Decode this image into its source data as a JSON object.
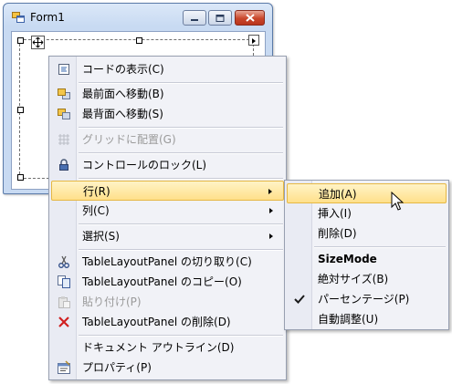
{
  "window": {
    "title": "Form1"
  },
  "context_menu": {
    "items": [
      {
        "label": "コードの表示(C)",
        "icon": "view-code-icon",
        "enabled": true
      },
      {
        "label": "最前面へ移動(B)",
        "icon": "bring-to-front-icon",
        "enabled": true
      },
      {
        "label": "最背面へ移動(S)",
        "icon": "send-to-back-icon",
        "enabled": true
      },
      {
        "label": "グリッドに配置(G)",
        "icon": "align-to-grid-icon",
        "enabled": false
      },
      {
        "label": "コントロールのロック(L)",
        "icon": "lock-icon",
        "enabled": true
      },
      {
        "label": "行(R)",
        "submenu": true,
        "highlighted": true
      },
      {
        "label": "列(C)",
        "submenu": true
      },
      {
        "label": "選択(S)",
        "submenu": true
      },
      {
        "label": "TableLayoutPanel の切り取り(C)",
        "icon": "cut-icon",
        "enabled": true
      },
      {
        "label": "TableLayoutPanel のコピー(O)",
        "icon": "copy-icon",
        "enabled": true
      },
      {
        "label": "貼り付け(P)",
        "icon": "paste-icon",
        "enabled": false
      },
      {
        "label": "TableLayoutPanel の削除(D)",
        "icon": "delete-icon",
        "enabled": true
      },
      {
        "label": "ドキュメント アウトライン(D)",
        "enabled": true
      },
      {
        "label": "プロパティ(P)",
        "icon": "properties-icon",
        "enabled": true
      }
    ]
  },
  "row_submenu": {
    "items": [
      {
        "label": "追加(A)",
        "highlighted": true
      },
      {
        "label": "挿入(I)"
      },
      {
        "label": "削除(D)"
      },
      {
        "label": "SizeMode",
        "bold": true
      },
      {
        "label": "絶対サイズ(B)"
      },
      {
        "label": "パーセンテージ(P)",
        "checked": true
      },
      {
        "label": "自動調整(U)"
      }
    ]
  },
  "colors": {
    "highlight": "#ffe08a",
    "highlight_border": "#e6b844",
    "menu_bg": "#f1f2f7",
    "disabled_text": "#9a9a9a"
  }
}
